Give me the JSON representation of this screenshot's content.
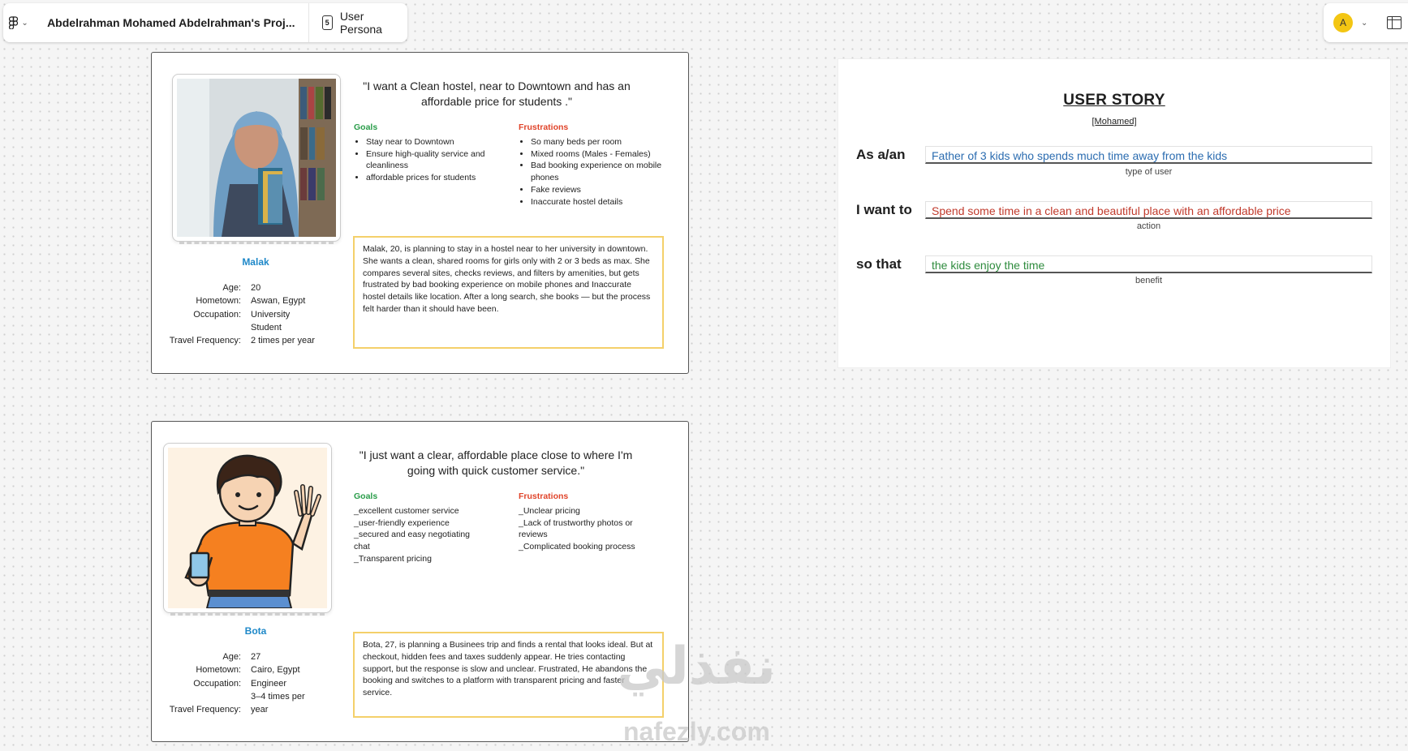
{
  "topbar": {
    "project_title": "Abdelrahman Mohamed Abdelrahman's Proj...",
    "page_tab": "User Persona",
    "page_icon_glyph": "5",
    "avatar_letter": "A",
    "avatar_color": "#f3c613"
  },
  "personas": [
    {
      "name": "Malak",
      "quote": "\"I want a Clean hostel, near to Downtown and has an affordable price for students .\"",
      "info": [
        {
          "k": "Age:",
          "v": "20"
        },
        {
          "k": "Hometown:",
          "v": "Aswan, Egypt"
        },
        {
          "k": "Occupation:",
          "v": "University Student"
        },
        {
          "k": "Travel Frequency:",
          "v": "2 times per year"
        }
      ],
      "goals_title": "Goals",
      "goals": [
        "Stay near to Downtown",
        "Ensure high-quality service and cleanliness",
        "affordable prices for students"
      ],
      "frustrations_title": "Frustrations",
      "frustrations": [
        "So many beds per room",
        "Mixed rooms (Males - Females)",
        "Bad booking experience on mobile phones",
        "Fake reviews",
        "Inaccurate hostel details"
      ],
      "scenario": "Malak, 20, is planning to stay in a hostel near to her university in downtown. She wants a clean, shared rooms for girls only with 2 or 3 beds as max. She compares several sites, checks reviews, and filters by amenities, but gets frustrated by bad booking experience on mobile phones and Inaccurate hostel details like location. After a long search, she books — but the process felt harder than it should have been."
    },
    {
      "name": "Bota",
      "quote": "\"I just want a clear, affordable place close to where I'm going with quick customer service.\"",
      "info": [
        {
          "k": "Age:",
          "v": "27"
        },
        {
          "k": "Hometown:",
          "v": "Cairo, Egypt"
        },
        {
          "k": "Occupation:",
          "v": "Engineer"
        },
        {
          "k": "Travel Frequency:",
          "v": "3–4 times per year"
        }
      ],
      "goals_title": "Goals",
      "goals": [
        "_excellent customer service",
        "_user-friendly experience",
        "_secured and easy negotiating chat",
        "_Transparent pricing"
      ],
      "frustrations_title": "Frustrations",
      "frustrations": [
        "_Unclear pricing",
        "_Lack of trustworthy photos or reviews",
        "_Complicated booking process"
      ],
      "scenario": "Bota, 27, is planning a Businees trip and finds a rental that looks ideal. But at checkout, hidden fees and taxes suddenly appear. He tries contacting support, but the response is slow and unclear. Frustrated, He abandons the booking and switches to a platform with transparent pricing and faster service."
    }
  ],
  "user_story": {
    "title": "USER STORY",
    "subtitle": "[Mohamed]",
    "rows": [
      {
        "label": "As a/an",
        "value": "Father of 3 kids who spends much time away from the kids",
        "hint": "type of user",
        "color": "#2b6cb0"
      },
      {
        "label": "I want to",
        "value": "Spend some time in a clean and beautiful place with an affordable price",
        "hint": "action",
        "color": "#c0392b"
      },
      {
        "label": "so that",
        "value": "the kids enjoy the time",
        "hint": "benefit",
        "color": "#2e8b3d"
      }
    ]
  },
  "watermark": {
    "arabic": "نفذلي",
    "latin": "nafezly.com"
  }
}
